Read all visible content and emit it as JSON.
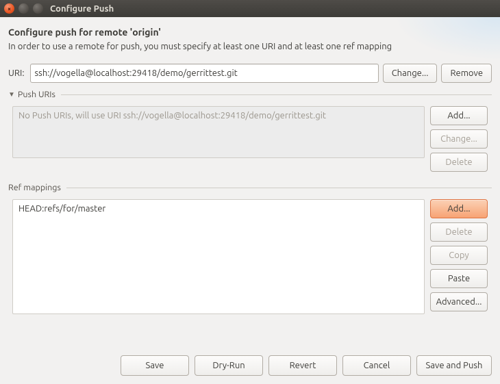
{
  "window": {
    "title": "Configure Push"
  },
  "header": {
    "title": "Configure push for remote 'origin'",
    "subtitle": "In order to use a remote for push, you must specify at least one URI and at least one ref mapping"
  },
  "uri": {
    "label": "URI:",
    "value": "ssh://vogella@localhost:29418/demo/gerrittest.git",
    "change": "Change...",
    "remove": "Remove"
  },
  "push_uris": {
    "title": "Push URIs",
    "placeholder": "No Push URIs, will use URI ssh://vogella@localhost:29418/demo/gerrittest.git",
    "add": "Add...",
    "change": "Change...",
    "delete": "Delete"
  },
  "ref_mappings": {
    "title": "Ref mappings",
    "items": [
      "HEAD:refs/for/master"
    ],
    "add": "Add...",
    "delete": "Delete",
    "copy": "Copy",
    "paste": "Paste",
    "advanced": "Advanced..."
  },
  "footer": {
    "save": "Save",
    "dry_run": "Dry-Run",
    "revert": "Revert",
    "cancel": "Cancel",
    "save_and_push": "Save and Push"
  }
}
